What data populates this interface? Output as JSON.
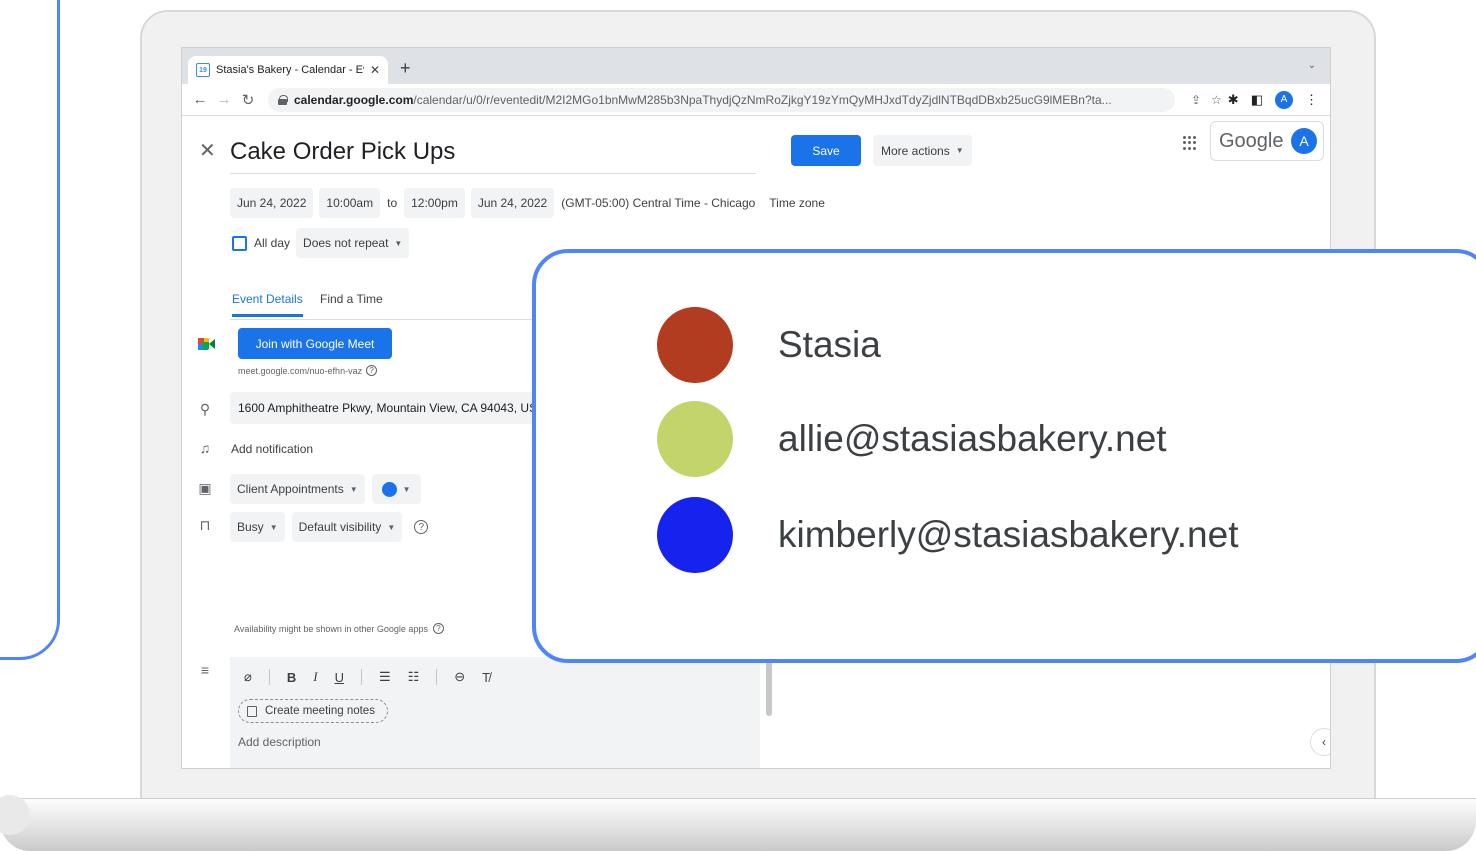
{
  "browser": {
    "tab_title": "Stasia's Bakery - Calendar - Ev",
    "tab_favicon_text": "19",
    "url_host": "calendar.google.com",
    "url_path": "/calendar/u/0/r/eventedit/M2I2MGo1bnMwM285b3NpaThydjQzNmRoZjkgY19zYmQyMHJxdTdyZjdlNTBqdDBxb25ucG9lMEBn?ta...",
    "profile_initial": "A"
  },
  "event": {
    "title": "Cake Order Pick Ups",
    "save_label": "Save",
    "more_actions_label": "More actions",
    "google_label": "Google",
    "avatar_initial": "A",
    "start_date": "Jun 24, 2022",
    "start_time": "10:00am",
    "to_label": "to",
    "end_time": "12:00pm",
    "end_date": "Jun 24, 2022",
    "timezone": "(GMT-05:00) Central Time - Chicago",
    "timezone_link": "Time zone",
    "all_day_label": "All day",
    "repeat": "Does not repeat"
  },
  "tabs": {
    "event_details": "Event Details",
    "find_a_time": "Find a Time"
  },
  "details": {
    "meet_button": "Join with Google Meet",
    "meet_link": "meet.google.com/nuo-efhn-vaz",
    "location": "1600 Amphitheatre Pkwy, Mountain View, CA 94043, US",
    "add_notification": "Add notification",
    "calendar": "Client Appointments",
    "status": "Busy",
    "visibility": "Default visibility",
    "availability_note": "Availability might be shown in other Google apps",
    "create_notes": "Create meeting notes",
    "description_placeholder": "Add description"
  },
  "guests": [
    {
      "name": "Stasia",
      "color": "#b23c1f"
    },
    {
      "name": "allie@stasiasbakery.net",
      "color": "#c3d46b"
    },
    {
      "name": "kimberly@stasiasbakery.net",
      "color": "#1623ee"
    }
  ],
  "colors": {
    "accent": "#1a73e8",
    "frame": "#4f86f7"
  }
}
